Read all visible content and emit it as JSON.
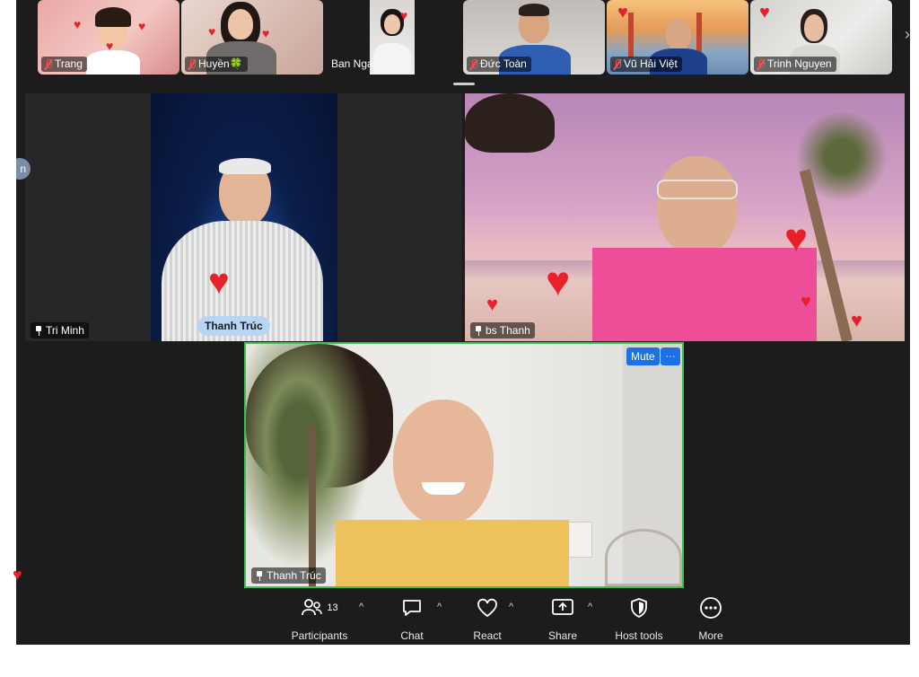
{
  "strip": {
    "participants": [
      {
        "name": "Trang",
        "muted": true
      },
      {
        "name": "Huyền🍀",
        "muted": true
      },
      {
        "name": "Ban Nga",
        "muted": false
      },
      {
        "name": "Đức Toàn",
        "muted": true
      },
      {
        "name": "Vũ Hải Việt",
        "muted": true
      },
      {
        "name": "Trinh Nguyen",
        "muted": true
      }
    ],
    "next_label": "›"
  },
  "main": {
    "tri_minh": {
      "name": "Tri Minh",
      "caption": "Thanh Trúc"
    },
    "bs_thanh": {
      "name": "bs Thanh"
    },
    "thanh_truc": {
      "name": "Thanh Trúc",
      "mute_label": "Mute",
      "more_label": "···"
    },
    "edge_label": "n"
  },
  "toolbar": {
    "participants_label": "Participants",
    "participants_count": "13",
    "chat_label": "Chat",
    "react_label": "React",
    "share_label": "Share",
    "host_tools_label": "Host tools",
    "more_label": "More",
    "caret": "^"
  },
  "colors": {
    "background": "#1c1c1c",
    "active_border": "#3fbf4f",
    "mute_button": "#1f6fe5",
    "heart": "#e8202a"
  }
}
